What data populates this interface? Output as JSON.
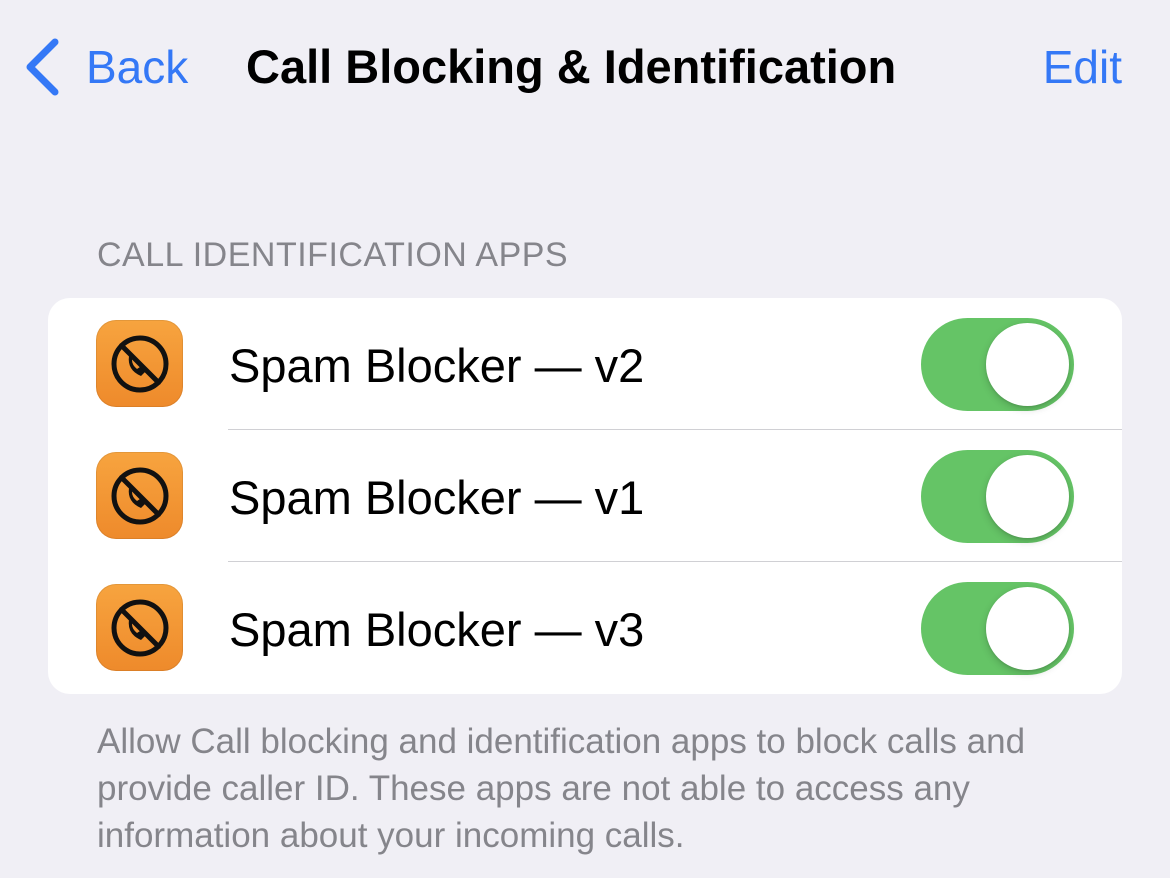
{
  "nav": {
    "back_label": "Back",
    "title": "Call Blocking & Identification",
    "edit_label": "Edit"
  },
  "section": {
    "header": "CALL IDENTIFICATION APPS"
  },
  "apps": [
    {
      "name": "Spam Blocker — v2",
      "enabled": true,
      "icon": "no-phone-icon"
    },
    {
      "name": "Spam Blocker — v1",
      "enabled": true,
      "icon": "no-phone-icon"
    },
    {
      "name": "Spam Blocker — v3",
      "enabled": true,
      "icon": "no-phone-icon"
    }
  ],
  "footer": {
    "text": "Allow Call blocking and identification apps to block calls and provide caller ID. These apps are not able to access any information about your incoming calls."
  },
  "colors": {
    "accent": "#3478f6",
    "toggle_on": "#65c466",
    "app_icon": "#f29532",
    "background": "#f0eff5"
  }
}
